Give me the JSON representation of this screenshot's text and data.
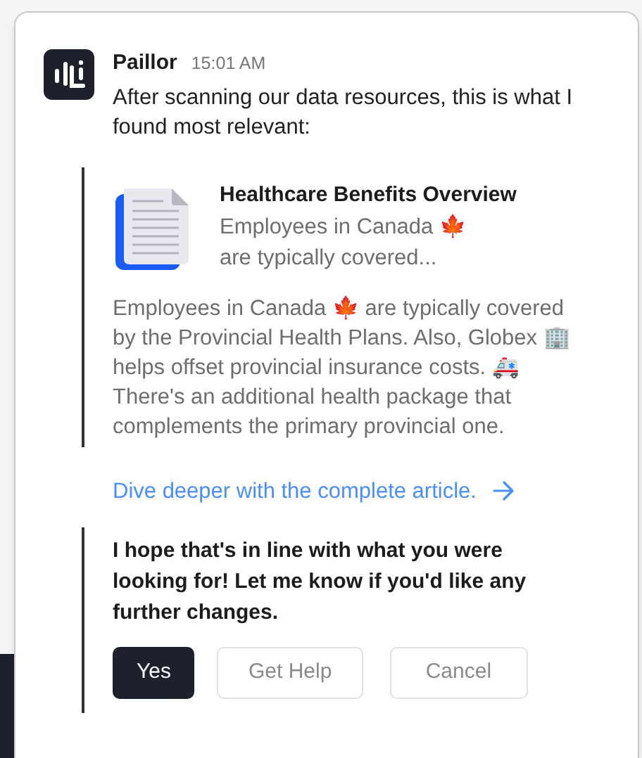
{
  "message": {
    "sender": "Paillor",
    "time": "15:01 AM",
    "text": "After scanning our data resources, this is what I found most relevant:"
  },
  "result": {
    "title": "Healthcare Benefits Overview",
    "snippet": "Employees in Canada 🍁 are typically covered...",
    "body": "Employees in Canada 🍁 are typically covered by the Provincial Health Plans. Also, Globex 🏢 helps offset provincial insurance costs. 🚑 There's an additional health package that complements the primary provincial one.",
    "link": "Dive deeper with the complete article."
  },
  "followup": "I hope that's in line with what you were looking for! Let me know if you'd like any further changes.",
  "buttons": [
    {
      "label": "Yes",
      "kind": "primary"
    },
    {
      "label": "Get Help",
      "kind": "secondary"
    },
    {
      "label": "Cancel",
      "kind": "secondary"
    }
  ]
}
